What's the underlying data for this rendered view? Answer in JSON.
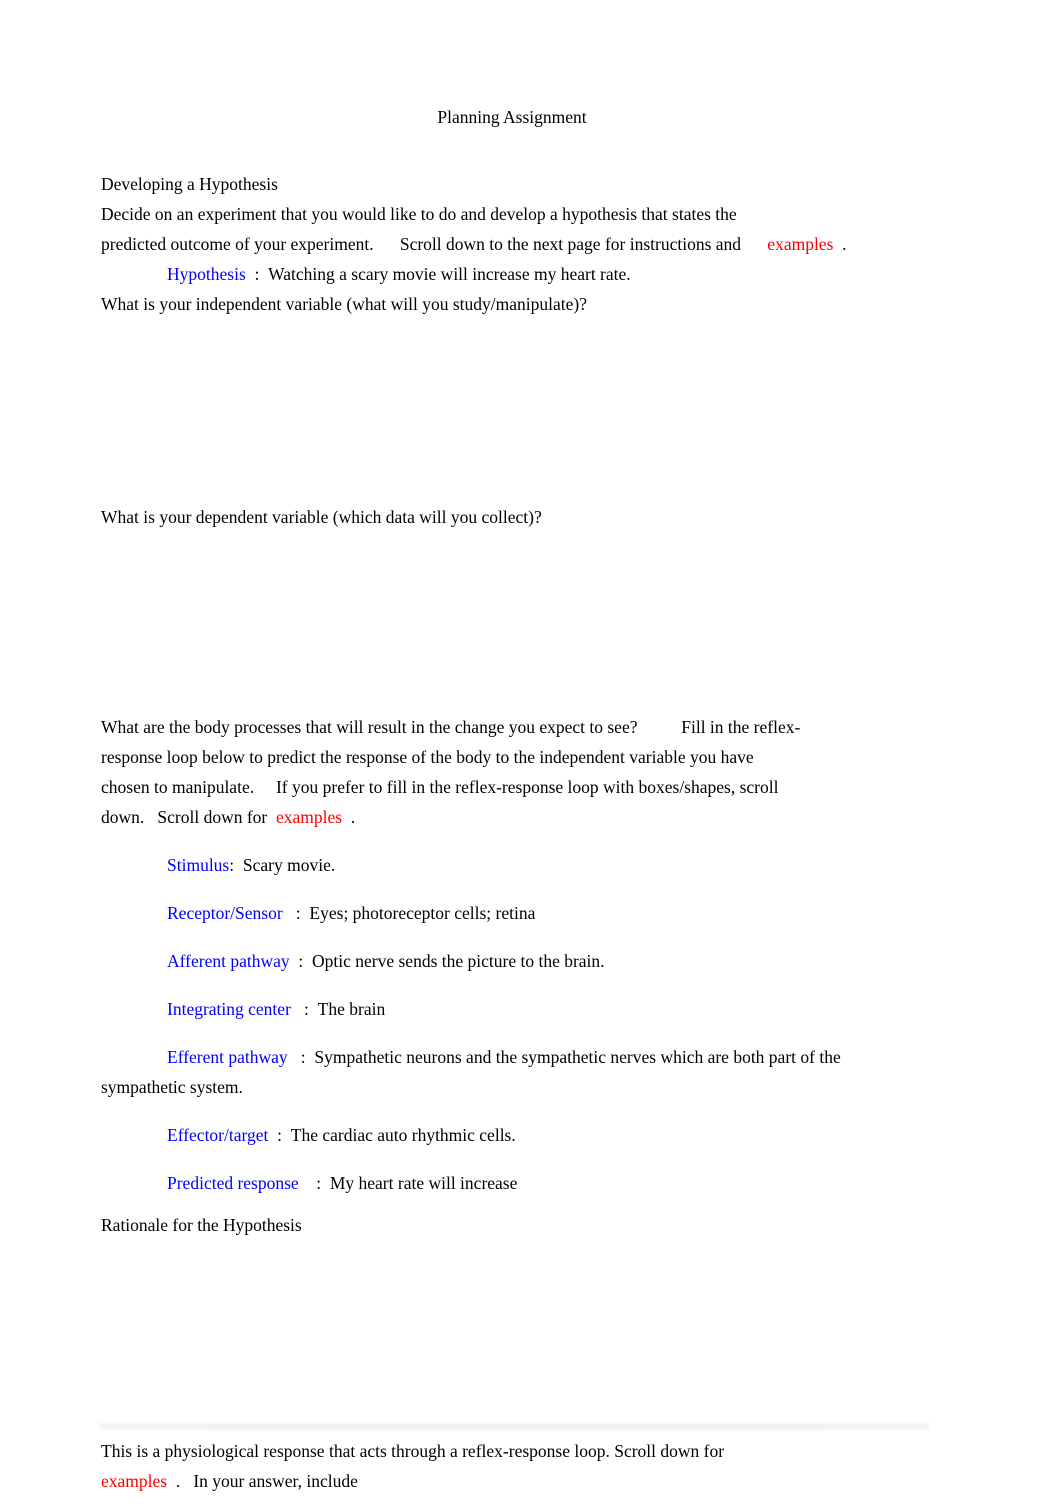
{
  "document": {
    "title": "Planning Assignment",
    "colors": {
      "label_blue": "#0000FF",
      "link_red": "#FF0000",
      "body_text": "#000000",
      "page_background": "#FFFFFF"
    },
    "sections": {
      "developing_heading": "Developing a Hypothesis",
      "developing_paragraph_line1": "Decide on an experiment that you would like to do and develop a hypothesis that states the",
      "developing_paragraph_line2a": "predicted outcome of your experiment.",
      "developing_paragraph_line2b": "Scroll down to the next page for instructions and",
      "developing_paragraph_examples_link": "examples",
      "developing_paragraph_line2_end": ".",
      "hypothesis_label": "Hypothesis",
      "hypothesis_colon": ":",
      "hypothesis_value": "Watching a scary movie will increase my heart rate.",
      "independent_variable_question": "What is your independent variable (what will you study/manipulate)?",
      "independent_variable_answer": "",
      "dependent_variable_question": "What is your dependent variable (which data will you collect)?",
      "dependent_variable_answer": "",
      "body_processes_line1a": "What are the body processes that will result in the change you expect to see?",
      "body_processes_line1b": "Fill in the reflex-",
      "body_processes_line2": "response loop below to predict the response of the body to the independent variable you have",
      "body_processes_line3a": "chosen to manipulate.",
      "body_processes_line3b": "If you prefer to fill in the reflex-response loop with boxes/shapes, scroll",
      "body_processes_line4a": "down.",
      "body_processes_line4b": "Scroll down for",
      "body_processes_examples_link": "examples",
      "body_processes_line4_end": ".",
      "rationale_heading": "Rationale for the Hypothesis",
      "rationale_answer": "",
      "closing_line1": "This is a physiological response that acts through a reflex-response loop. Scroll down for",
      "closing_examples_link": "examples",
      "closing_line2_end": ".",
      "closing_line2": "In your answer, include"
    },
    "reflex_loop": [
      {
        "label": "Stimulus",
        "colon": ":",
        "value": "Scary movie."
      },
      {
        "label": "Receptor/Sensor",
        "colon": ":",
        "value": "Eyes; photoreceptor cells; retina"
      },
      {
        "label": "Afferent pathway",
        "colon": ":",
        "value": "Optic nerve sends the picture to the brain."
      },
      {
        "label": "Integrating center",
        "colon": ":",
        "value": "The brain"
      },
      {
        "label": "Efferent pathway",
        "colon": ":",
        "value": "Sympathetic neurons and the sympathetic nerves which are both part of the sympathetic system."
      },
      {
        "label": "Effector/target",
        "colon": ":",
        "value": "The cardiac auto rhythmic cells."
      },
      {
        "label": "Predicted response",
        "colon": ":",
        "value": "My heart rate will increase"
      }
    ]
  }
}
